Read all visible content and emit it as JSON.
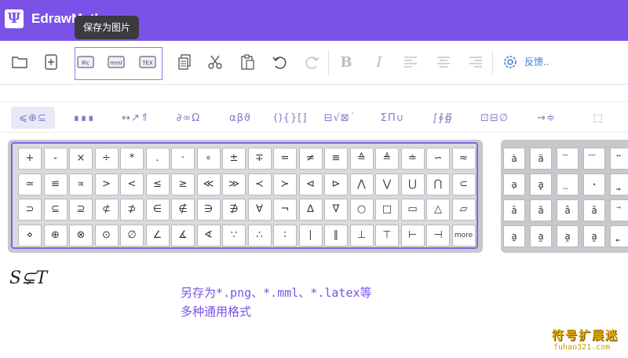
{
  "app": {
    "title": "EdrawMath"
  },
  "tooltip": "保存为图片",
  "toolbar": {
    "export_labels": [
      "Pic",
      "mml",
      "TEX"
    ],
    "bold": "B",
    "italic": "I",
    "feedback": "反馈.."
  },
  "tabs": [
    "⩽⊕⊆",
    "∎∎∎",
    "↔↗⇑",
    "∂∞Ω",
    "αβϑ",
    "(){}[]",
    "⊟√⊠˙",
    "ΣΠ∪",
    "∫∮∯",
    "⊡⊟∅",
    "→≑",
    "⬚"
  ],
  "symbols": [
    [
      "+",
      "-",
      "×",
      "÷",
      "*",
      ".",
      "·",
      "∘",
      "±",
      "∓",
      "=",
      "≠",
      "≡",
      "≙",
      "≜",
      "≐",
      "∽",
      "≈"
    ],
    [
      "≃",
      "≌",
      "∝",
      ">",
      "<",
      "≤",
      "≥",
      "≪",
      "≫",
      "≺",
      "≻",
      "⊲",
      "⊳",
      "⋀",
      "⋁",
      "⋃",
      "⋂",
      "⊂"
    ],
    [
      "⊃",
      "⊆",
      "⊇",
      "⊄",
      "⊅",
      "∈",
      "∉",
      "∋",
      "∌",
      "∀",
      "¬",
      "∆",
      "∇",
      "○",
      "□",
      "▭",
      "△",
      "▱"
    ],
    [
      "⋄",
      "⊕",
      "⊗",
      "⊙",
      "∅",
      "∠",
      "∡",
      "∢",
      "∵",
      "∴",
      "∶",
      "∣",
      "∥",
      "⊥",
      "⊤",
      "⊢",
      "⊣",
      "more"
    ]
  ],
  "side_symbols": [
    [
      "ȧ",
      "ä",
      "⃛",
      "⃜",
      "⃡"
    ],
    [
      "ạ",
      "ḁ",
      "⃨",
      "ꞏ",
      "⃯"
    ],
    [
      "ā",
      "ã",
      "â",
      "ǎ",
      "⃗"
    ],
    [
      "a̱",
      "a̰",
      "a̭",
      "a̬",
      "⃮"
    ]
  ],
  "editor": {
    "formula": "S⊊T",
    "note_line1": "另存为*.png、*.mml、*.latex等",
    "note_line2": "多种通用格式"
  },
  "watermark": {
    "line1": "符号扩展迷",
    "line2": "fuhao321.com"
  }
}
